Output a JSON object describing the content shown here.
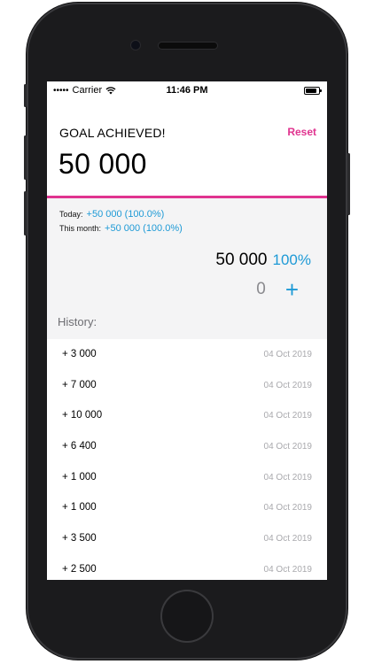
{
  "status_bar": {
    "carrier": "Carrier",
    "time": "11:46 PM",
    "battery_level": 0.9
  },
  "header": {
    "goal_status": "GOAL ACHIEVED!",
    "reset_label": "Reset",
    "goal_amount": "50 000",
    "accent_color": "#e0338f"
  },
  "stats": {
    "today_label": "Today:",
    "today_value": "+50 000 (100.0%)",
    "month_label": "This month:",
    "month_value": "+50 000 (100.0%)",
    "total_value": "50 000",
    "total_percent": "100%",
    "input_value": "0",
    "plus_label": "+",
    "link_color": "#1e9ad6"
  },
  "history": {
    "label": "History:",
    "items": [
      {
        "amount": "+ 3 000",
        "date": "04 Oct 2019"
      },
      {
        "amount": "+ 7 000",
        "date": "04 Oct 2019"
      },
      {
        "amount": "+ 10 000",
        "date": "04 Oct 2019"
      },
      {
        "amount": "+ 6 400",
        "date": "04 Oct 2019"
      },
      {
        "amount": "+ 1 000",
        "date": "04 Oct 2019"
      },
      {
        "amount": "+ 1 000",
        "date": "04 Oct 2019"
      },
      {
        "amount": "+ 3 500",
        "date": "04 Oct 2019"
      },
      {
        "amount": "+ 2 500",
        "date": "04 Oct 2019"
      }
    ]
  },
  "icons": {
    "wifi": "wifi-icon",
    "battery": "battery-icon",
    "signal": "signal-icon"
  }
}
